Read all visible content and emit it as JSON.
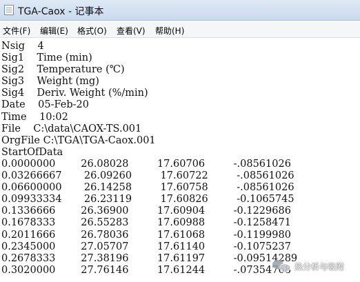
{
  "window": {
    "title": "TGA-Caox - 记事本"
  },
  "menu": {
    "file": "文件(F)",
    "edit": "编辑(E)",
    "format": "格式(O)",
    "view": "查看(V)",
    "help": "帮助(H)"
  },
  "document": {
    "content": "Nsig    4\nSig1    Time (min)\nSig2    Temperature (℃)\nSig3    Weight (mg)\nSig4    Deriv. Weight (%/min)\nDate    05-Feb-20\nTime    10:02\nFile    C:\\data\\CAOX-TS.001\nOrgFile C:\\TGA\\TGA-Caox.001\nStartOfData\n0.0000000        26.08028         17.60706         -.08561026\n0.03266667       26.09260         17.60722         -.08561026\n0.06600000       26.14258         17.60758         -.08561026\n0.09933334       26.23119         17.60826         -0.1065745\n0.1336666        26.36900         17.60904         -0.1229686\n0.1678333        26.55283         17.60988         -0.1258471\n0.2011666        26.78036         17.61068         -0.1199980\n0.2345000        27.05707         17.61140         -0.1075237\n0.2678333        27.38196         17.61197         -0.09514289\n0.3020000        27.76146         17.61244         -.07354768"
  },
  "watermark": {
    "text": "热分析与吸附",
    "icon": "wechat-icon"
  }
}
